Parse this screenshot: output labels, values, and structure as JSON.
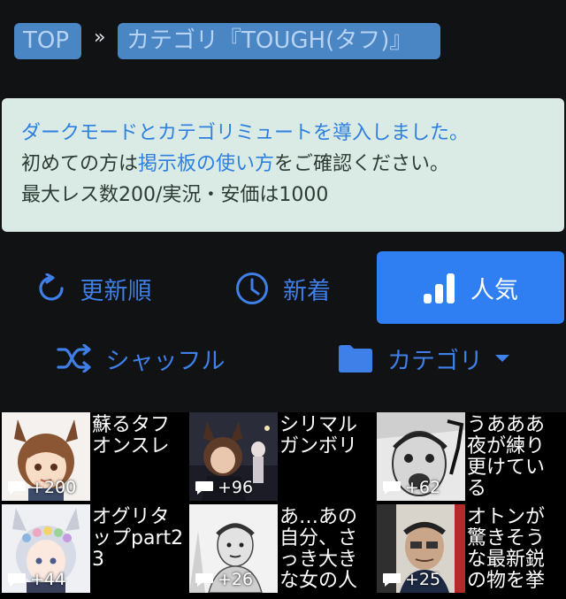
{
  "breadcrumb": {
    "top": "TOP",
    "separator": "»",
    "category": "カテゴリ『TOUGH(タフ)』"
  },
  "notice": {
    "line1": "ダークモードとカテゴリミュートを導入しました。",
    "line2_prefix": "初めての方は",
    "line2_link": "掲示板の使い方",
    "line2_suffix": "をご確認ください。",
    "line3": "最大レス数200/実況・安価は1000"
  },
  "sort": {
    "update_label": "更新順",
    "new_label": "新着",
    "popular_label": "人気",
    "shuffle_label": "シャッフル",
    "category_label": "カテゴリ",
    "active": "popular"
  },
  "threads": [
    {
      "title": "蘇るタフオンスレ",
      "count": "+200",
      "thumb": "horse-girl-brown"
    },
    {
      "title": "シリマルガンボリ",
      "count": "+96",
      "thumb": "horse-girl-dark"
    },
    {
      "title": "うあああ夜が練り更けている",
      "count": "+62",
      "thumb": "manga-face-shout"
    },
    {
      "title": "オグリタップpart23",
      "count": "+44",
      "thumb": "horse-girl-white"
    },
    {
      "title": "あ…あの自分、さっき大きな女の人",
      "count": "+26",
      "thumb": "manga-man-sketch"
    },
    {
      "title": "オトンが驚きそうな最新鋭の物を挙",
      "count": "+25",
      "thumb": "manga-comic-cover"
    }
  ],
  "colors": {
    "accent": "#2f7ff2",
    "crumb_bg": "#4a85c4",
    "notice_bg": "#d9ebe4",
    "background": "#111214"
  }
}
